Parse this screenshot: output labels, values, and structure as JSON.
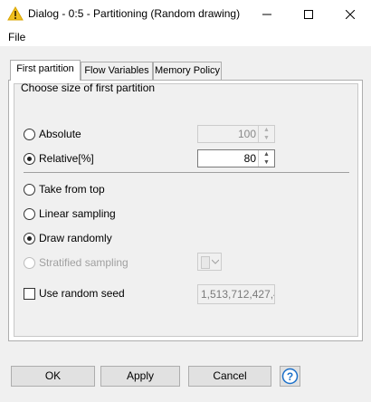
{
  "window": {
    "title": "Dialog - 0:5 - Partitioning (Random drawing)"
  },
  "menu": {
    "file_label": "File"
  },
  "tabs": [
    {
      "label": "First partition",
      "active": true
    },
    {
      "label": "Flow Variables",
      "active": false
    },
    {
      "label": "Memory Policy",
      "active": false
    }
  ],
  "group": {
    "title": "Choose size of first partition"
  },
  "size": {
    "absolute_label": "Absolute",
    "absolute_value": "100",
    "relative_label": "Relative[%]",
    "relative_value": "80",
    "selected": "relative"
  },
  "sampling": {
    "take_from_top": "Take from top",
    "linear_sampling": "Linear sampling",
    "draw_randomly": "Draw randomly",
    "stratified_sampling": "Stratified sampling",
    "selected": "draw_randomly"
  },
  "seed": {
    "label": "Use random seed",
    "value": "1,513,712,427,4",
    "checked": false
  },
  "buttons": {
    "ok": "OK",
    "apply": "Apply",
    "cancel": "Cancel",
    "help": "?"
  },
  "colors": {
    "accent": "#1a6fc9",
    "warning_icon": "#f0c020"
  }
}
